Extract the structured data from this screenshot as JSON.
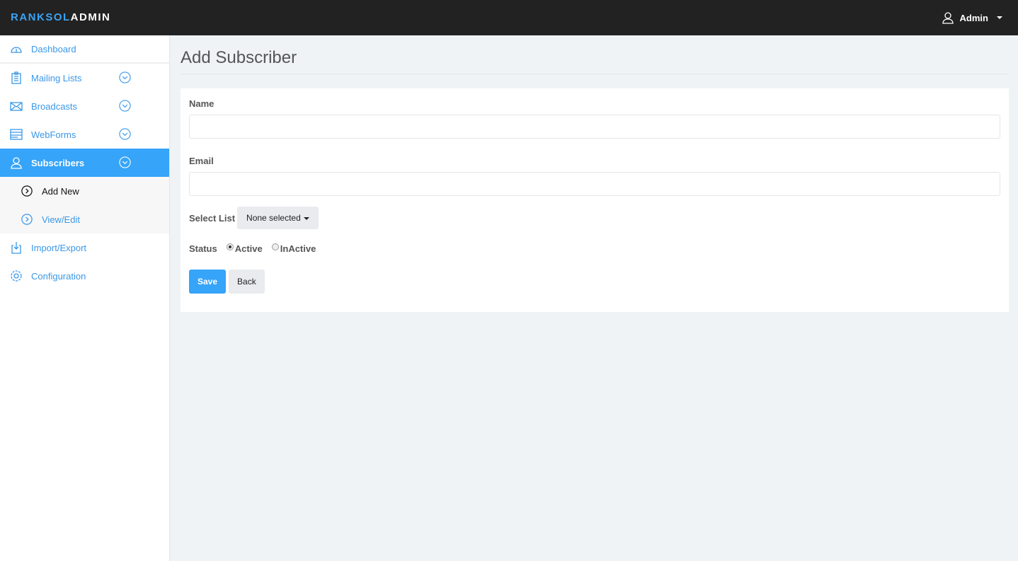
{
  "header": {
    "brand_a": "RANKSOL",
    "brand_b": "ADMIN",
    "user": "Admin"
  },
  "sidebar": {
    "items": [
      {
        "label": "Dashboard"
      },
      {
        "label": "Mailing Lists"
      },
      {
        "label": "Broadcasts"
      },
      {
        "label": "WebForms"
      },
      {
        "label": "Subscribers"
      },
      {
        "label": "Add New"
      },
      {
        "label": "View/Edit"
      },
      {
        "label": "Import/Export"
      },
      {
        "label": "Configuration"
      }
    ]
  },
  "page": {
    "title": "Add Subscriber"
  },
  "form": {
    "name_label": "Name",
    "name_value": "",
    "email_label": "Email",
    "email_value": "",
    "select_label": "Select List",
    "select_value": "None selected",
    "status_label": "Status",
    "status_options": [
      "Active",
      "InActive"
    ],
    "status_selected": "Active",
    "save": "Save",
    "back": "Back"
  },
  "colors": {
    "accent": "#36a4f8",
    "topbar": "#222222"
  }
}
